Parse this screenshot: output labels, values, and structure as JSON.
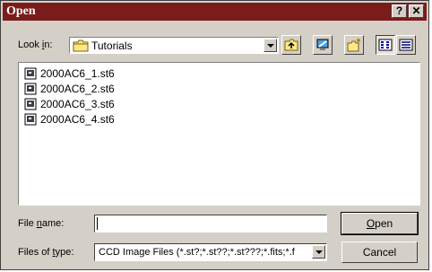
{
  "window": {
    "title": "Open",
    "help_label": "?",
    "close_label": "✕"
  },
  "lookin": {
    "label_pre": "Look ",
    "label_key": "i",
    "label_post": "n:",
    "folder": "Tutorials",
    "folder_icon": "folder-icon"
  },
  "toolbar": [
    {
      "name": "up-one-level-button",
      "icon": "up-folder-icon"
    },
    {
      "name": "desktop-button",
      "icon": "desktop-icon"
    },
    {
      "name": "new-folder-button",
      "icon": "new-folder-icon"
    },
    {
      "name": "list-view-button",
      "icon": "list-view-icon"
    },
    {
      "name": "details-view-button",
      "icon": "details-view-icon"
    }
  ],
  "files": [
    {
      "name": "2000AC6_1.st6"
    },
    {
      "name": "2000AC6_2.st6"
    },
    {
      "name": "2000AC6_3.st6"
    },
    {
      "name": "2000AC6_4.st6"
    }
  ],
  "filename": {
    "label_pre": "File ",
    "label_key": "n",
    "label_post": "ame:",
    "value": ""
  },
  "filetype": {
    "label_pre": "Files of ",
    "label_key": "t",
    "label_post": "ype:",
    "selected": "CCD Image Files  (*.st?;*.st??;*.st???;*.fits;*.f"
  },
  "buttons": {
    "open_key": "O",
    "open_rest": "pen",
    "cancel": "Cancel"
  },
  "colors": {
    "titlebar": "#7a1c1c",
    "face": "#d4d0c8"
  }
}
